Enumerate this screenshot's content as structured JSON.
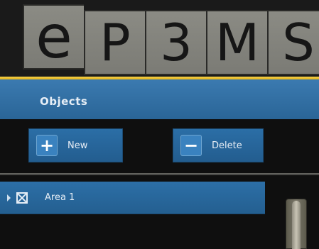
{
  "logo": {
    "letters": [
      "e",
      "P",
      "3",
      "M",
      "S"
    ]
  },
  "panel": {
    "title": "Objects"
  },
  "toolbar": {
    "new_label": "New",
    "delete_label": "Delete",
    "new_icon": "plus-icon",
    "delete_icon": "minus-icon"
  },
  "tree": {
    "items": [
      {
        "label": "Area 1",
        "checked": true,
        "expanded": false
      }
    ]
  },
  "colors": {
    "accent_blue": "#2b6ea6",
    "gold": "#f2c531",
    "logo_tile": "#85857e"
  }
}
